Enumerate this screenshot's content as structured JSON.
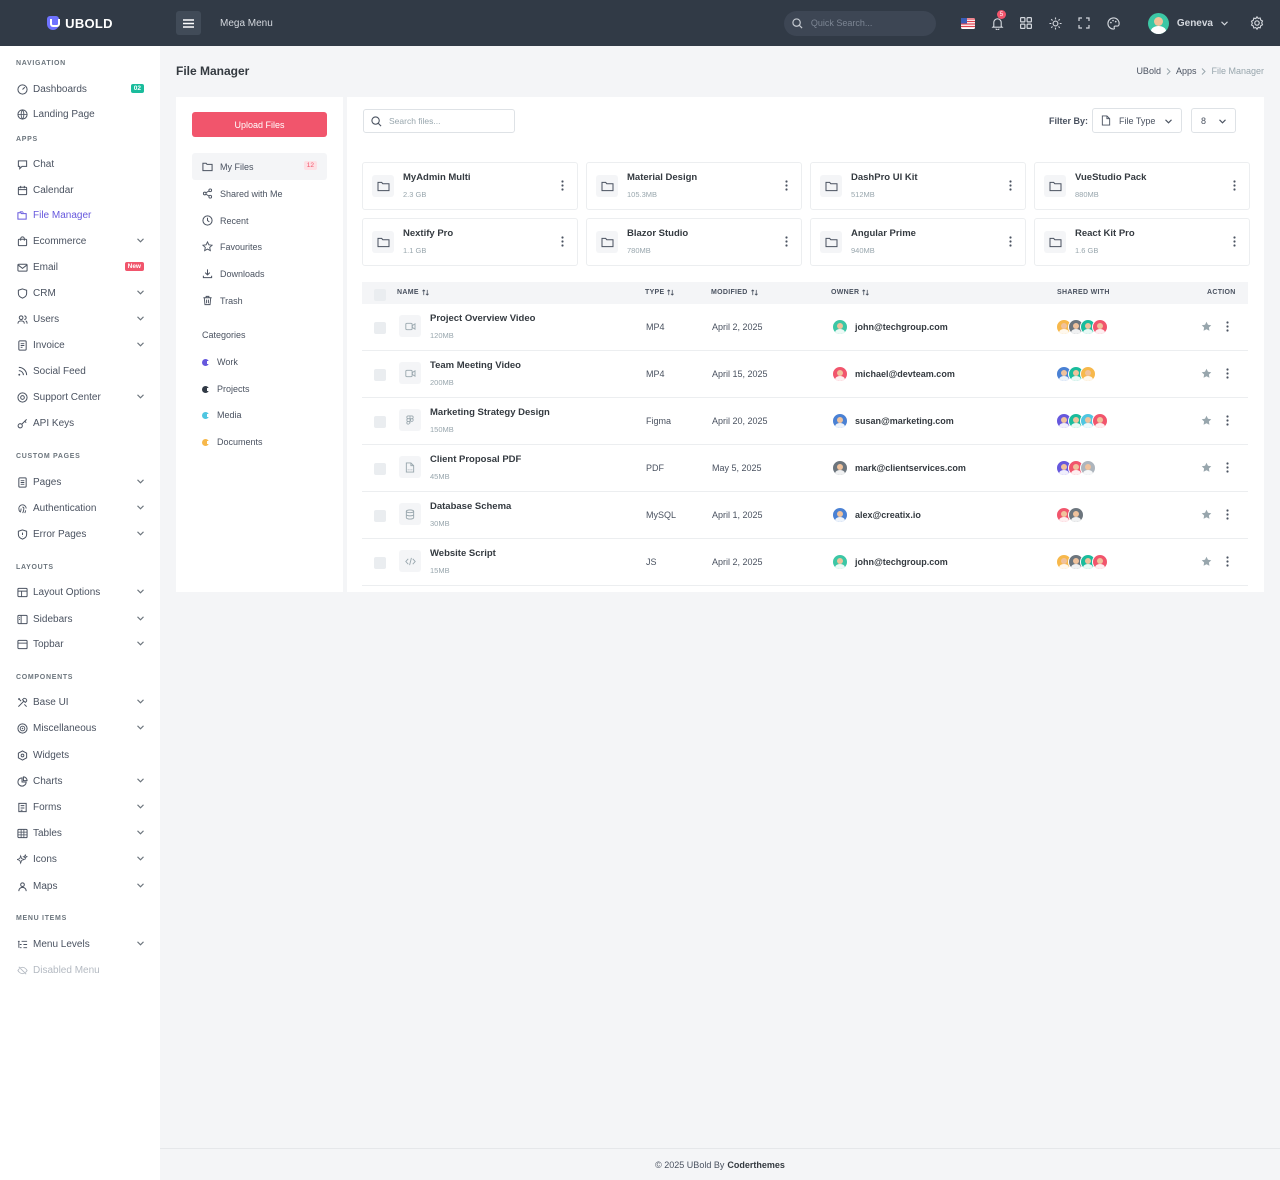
{
  "brand": {
    "name": "UBOLD"
  },
  "topbar": {
    "mega_menu": "Mega Menu",
    "search_placeholder": "Quick Search...",
    "notification_count": "5",
    "user_name": "Geneva"
  },
  "sidebar": {
    "sections": {
      "navigation": "NAVIGATION",
      "apps": "APPS",
      "custom_pages": "CUSTOM PAGES",
      "layouts": "LAYOUTS",
      "components": "COMPONENTS",
      "menu_items": "MENU ITEMS"
    },
    "items": {
      "dashboards": "Dashboards",
      "dashboards_badge": "02",
      "landing_page": "Landing Page",
      "chat": "Chat",
      "calendar": "Calendar",
      "file_manager": "File Manager",
      "ecommerce": "Ecommerce",
      "email": "Email",
      "email_badge": "New",
      "crm": "CRM",
      "users": "Users",
      "invoice": "Invoice",
      "social_feed": "Social Feed",
      "support_center": "Support Center",
      "api_keys": "API Keys",
      "pages": "Pages",
      "authentication": "Authentication",
      "error_pages": "Error Pages",
      "layout_options": "Layout Options",
      "sidebars": "Sidebars",
      "topbar": "Topbar",
      "base_ui": "Base UI",
      "miscellaneous": "Miscellaneous",
      "widgets": "Widgets",
      "charts": "Charts",
      "forms": "Forms",
      "tables": "Tables",
      "icons": "Icons",
      "maps": "Maps",
      "menu_levels": "Menu Levels",
      "disabled_menu": "Disabled Menu"
    }
  },
  "page": {
    "title": "File Manager",
    "breadcrumb": [
      "UBold",
      "Apps",
      "File Manager"
    ]
  },
  "left_panel": {
    "upload_label": "Upload Files",
    "menu": {
      "my_files": "My Files",
      "my_files_count": "12",
      "shared": "Shared with Me",
      "recent": "Recent",
      "favourites": "Favourites",
      "downloads": "Downloads",
      "trash": "Trash"
    },
    "categories_title": "Categories",
    "categories": [
      {
        "label": "Work",
        "color": "#6658dd"
      },
      {
        "label": "Projects",
        "color": "#313a46"
      },
      {
        "label": "Media",
        "color": "#4fc6e1"
      },
      {
        "label": "Documents",
        "color": "#f7b84b"
      }
    ]
  },
  "main": {
    "search_placeholder": "Search files...",
    "filter_label": "Filter By:",
    "filter_value": "File Type",
    "count_value": "8",
    "folders": [
      {
        "name": "MyAdmin Multi",
        "size": "2.3 GB"
      },
      {
        "name": "Material Design",
        "size": "105.3MB"
      },
      {
        "name": "DashPro UI Kit",
        "size": "512MB"
      },
      {
        "name": "VueStudio Pack",
        "size": "880MB"
      },
      {
        "name": "Nextify Pro",
        "size": "1.1 GB"
      },
      {
        "name": "Blazor Studio",
        "size": "780MB"
      },
      {
        "name": "Angular Prime",
        "size": "940MB"
      },
      {
        "name": "React Kit Pro",
        "size": "1.6 GB"
      }
    ],
    "table": {
      "headers": {
        "name": "NAME",
        "type": "TYPE",
        "modified": "MODIFIED",
        "owner": "OWNER",
        "shared": "SHARED WITH",
        "action": "ACTION"
      },
      "rows": [
        {
          "name": "Project Overview Video",
          "size": "120MB",
          "type": "MP4",
          "modified": "April 2, 2025",
          "owner": "john@techgroup.com",
          "icon": "video-icon",
          "owner_color": "#3cc7a5",
          "shared": [
            "#f7b84b",
            "#6c757d",
            "#1abc9c",
            "#f1556c"
          ]
        },
        {
          "name": "Team Meeting Video",
          "size": "200MB",
          "type": "MP4",
          "modified": "April 15, 2025",
          "owner": "michael@devteam.com",
          "icon": "video-icon",
          "owner_color": "#f1556c",
          "shared": [
            "#4a81d4",
            "#1abc9c",
            "#f7b84b"
          ]
        },
        {
          "name": "Marketing Strategy Design",
          "size": "150MB",
          "type": "Figma",
          "modified": "April 20, 2025",
          "owner": "susan@marketing.com",
          "icon": "figma-icon",
          "owner_color": "#4a81d4",
          "shared": [
            "#6658dd",
            "#1abc9c",
            "#4fc6e1",
            "#f1556c"
          ]
        },
        {
          "name": "Client Proposal PDF",
          "size": "45MB",
          "type": "PDF",
          "modified": "May 5, 2025",
          "owner": "mark@clientservices.com",
          "icon": "pdf-icon",
          "owner_color": "#6c757d",
          "shared": [
            "#6658dd",
            "#f1556c",
            "#adb5bd"
          ]
        },
        {
          "name": "Database Schema",
          "size": "30MB",
          "type": "MySQL",
          "modified": "April 1, 2025",
          "owner": "alex@creatix.io",
          "icon": "database-icon",
          "owner_color": "#4a81d4",
          "shared": [
            "#f1556c",
            "#6c757d"
          ]
        },
        {
          "name": "Website Script",
          "size": "15MB",
          "type": "JS",
          "modified": "April 2, 2025",
          "owner": "john@techgroup.com",
          "icon": "code-icon",
          "owner_color": "#3cc7a5",
          "shared": [
            "#f7b84b",
            "#6c757d",
            "#1abc9c",
            "#f1556c"
          ]
        }
      ]
    }
  },
  "footer": {
    "text": "© 2025 UBold By",
    "brand": "Coderthemes"
  }
}
